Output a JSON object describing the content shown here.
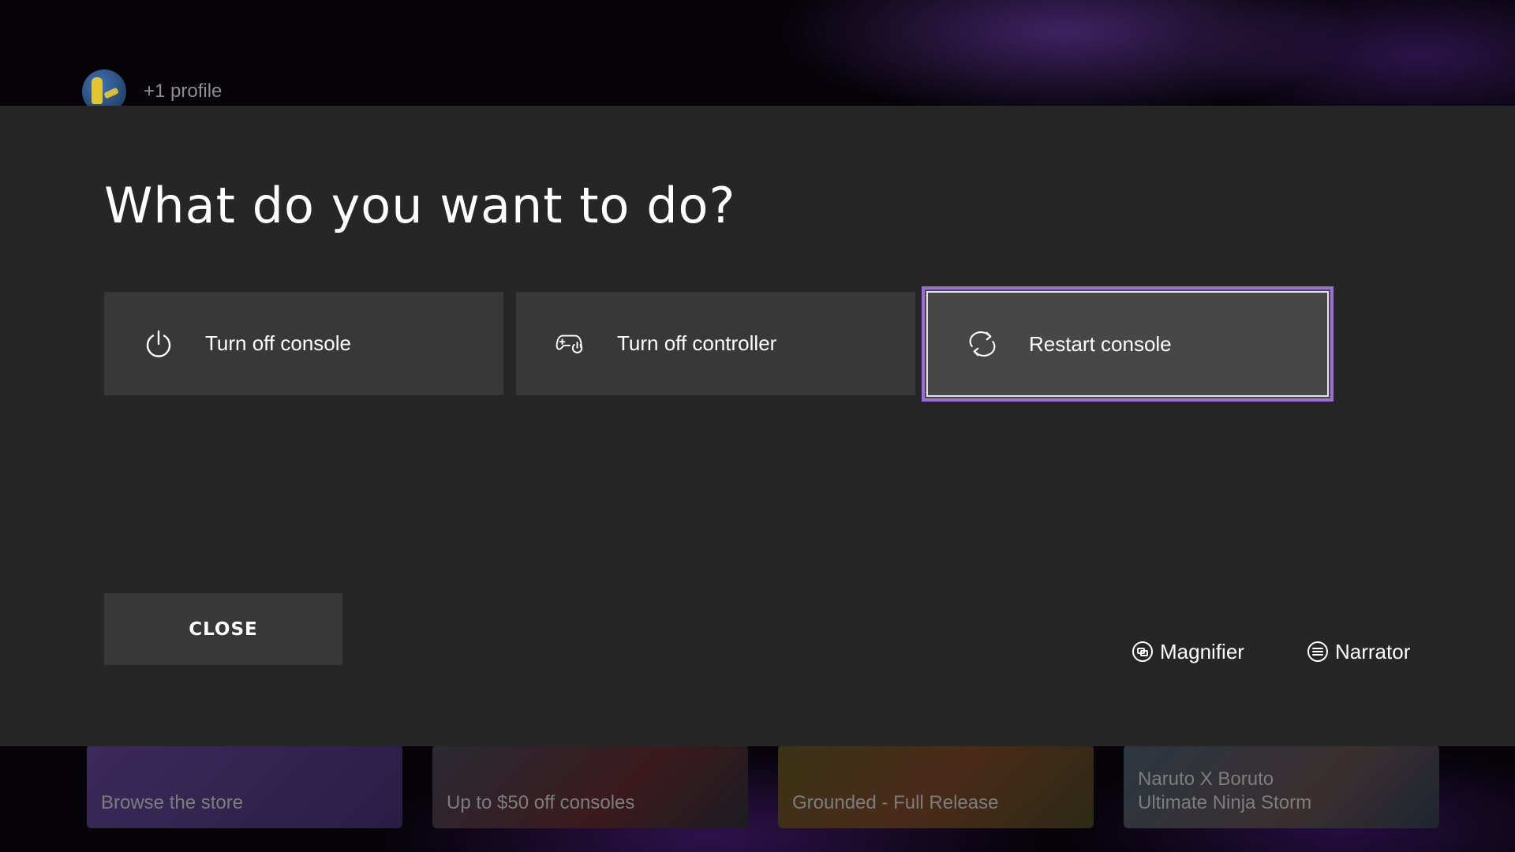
{
  "background": {
    "profile": {
      "text": "+1 profile"
    },
    "tiles": [
      {
        "title": "Browse the store",
        "subtitle": ""
      },
      {
        "title": "Up to $50 off consoles",
        "subtitle": ""
      },
      {
        "title": "Grounded - Full Release",
        "subtitle": ""
      },
      {
        "title": "Naruto X Boruto",
        "subtitle": "Ultimate Ninja Storm"
      }
    ]
  },
  "dialog": {
    "title": "What do you want to do?",
    "options": [
      {
        "label": "Turn off console",
        "icon": "power-icon",
        "selected": false
      },
      {
        "label": "Turn off controller",
        "icon": "controller-power-icon",
        "selected": false
      },
      {
        "label": "Restart console",
        "icon": "restart-icon",
        "selected": true
      }
    ],
    "close_label": "CLOSE",
    "accessibility": [
      {
        "label": "Magnifier",
        "icon": "magnifier-icon"
      },
      {
        "label": "Narrator",
        "icon": "narrator-icon"
      }
    ]
  },
  "colors": {
    "dialog_bg": "#262626",
    "option_bg": "#383838",
    "selected_bg": "#474747",
    "focus_border": "#9a6ed6"
  }
}
